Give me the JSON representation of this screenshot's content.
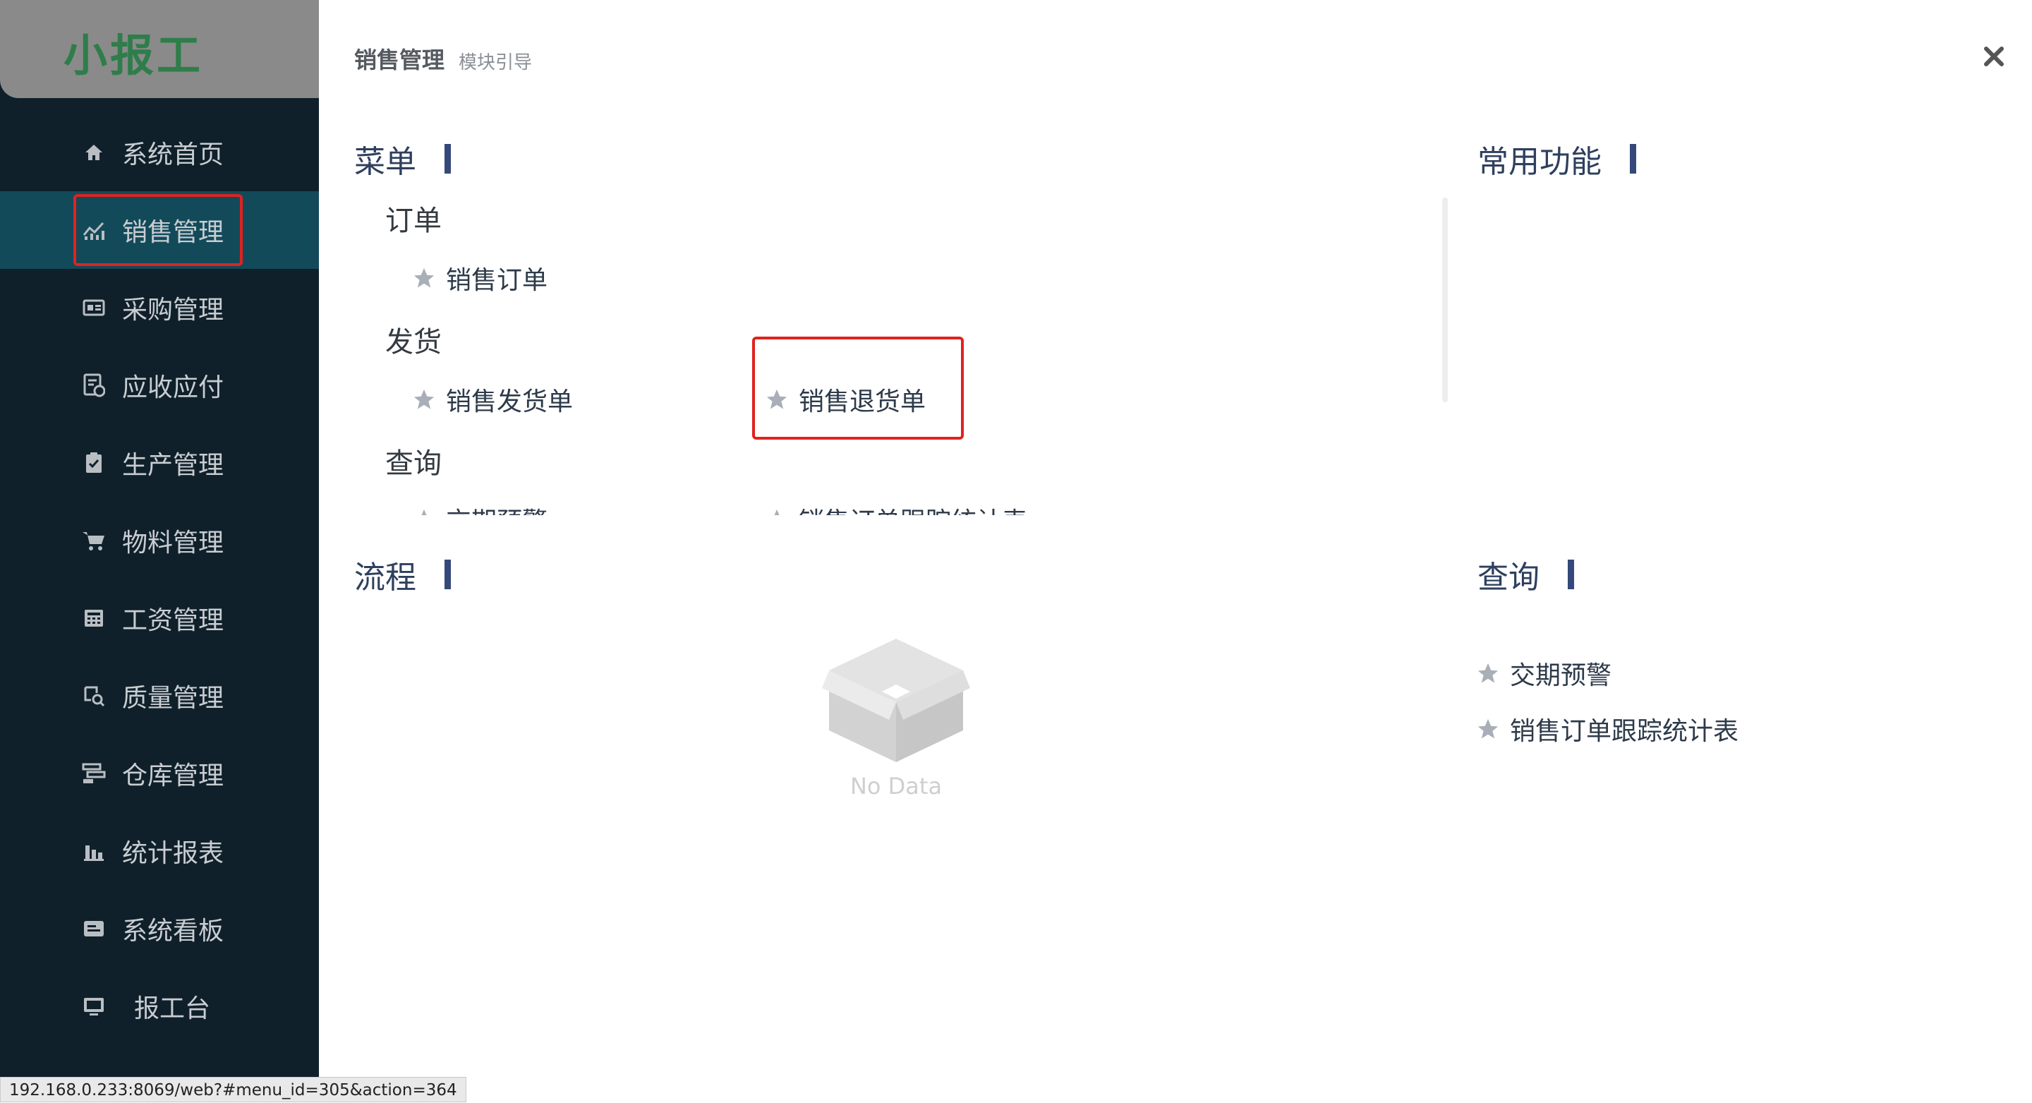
{
  "app": {
    "logo": "小报工"
  },
  "sidebar": {
    "items": [
      {
        "label": "系统首页",
        "icon": "home-icon"
      },
      {
        "label": "销售管理",
        "icon": "sales-chart-icon",
        "active": true
      },
      {
        "label": "采购管理",
        "icon": "purchase-icon"
      },
      {
        "label": "应收应付",
        "icon": "ledger-icon"
      },
      {
        "label": "生产管理",
        "icon": "clipboard-icon"
      },
      {
        "label": "物料管理",
        "icon": "cart-icon"
      },
      {
        "label": "工资管理",
        "icon": "calculator-icon"
      },
      {
        "label": "质量管理",
        "icon": "quality-icon"
      },
      {
        "label": "仓库管理",
        "icon": "warehouse-icon"
      },
      {
        "label": "统计报表",
        "icon": "bar-chart-icon"
      },
      {
        "label": "系统看板",
        "icon": "board-icon"
      },
      {
        "label": "报工台",
        "icon": "monitor-icon"
      }
    ]
  },
  "header": {
    "title": "销售管理",
    "subtitle": "模块引导"
  },
  "sections": {
    "menu": {
      "title": "菜单",
      "groups": [
        {
          "title": "订单",
          "links": [
            "销售订单"
          ]
        },
        {
          "title": "发货",
          "links": [
            "销售发货单",
            "销售退货单"
          ]
        },
        {
          "title": "查询",
          "links": [
            "交期预警",
            "销售订单跟踪统计表"
          ]
        }
      ]
    },
    "common": {
      "title": "常用功能"
    },
    "flow": {
      "title": "流程",
      "empty_text": "No Data"
    },
    "query": {
      "title": "查询",
      "links": [
        "交期预警",
        "销售订单跟踪统计表"
      ]
    }
  },
  "status_url": "192.168.0.233:8069/web?#menu_id=305&action=364",
  "colors": {
    "sidebar_bg": "#0f202b",
    "active_bg": "#124a5a",
    "accent_bar": "#34497a",
    "highlight": "#e0221f"
  }
}
